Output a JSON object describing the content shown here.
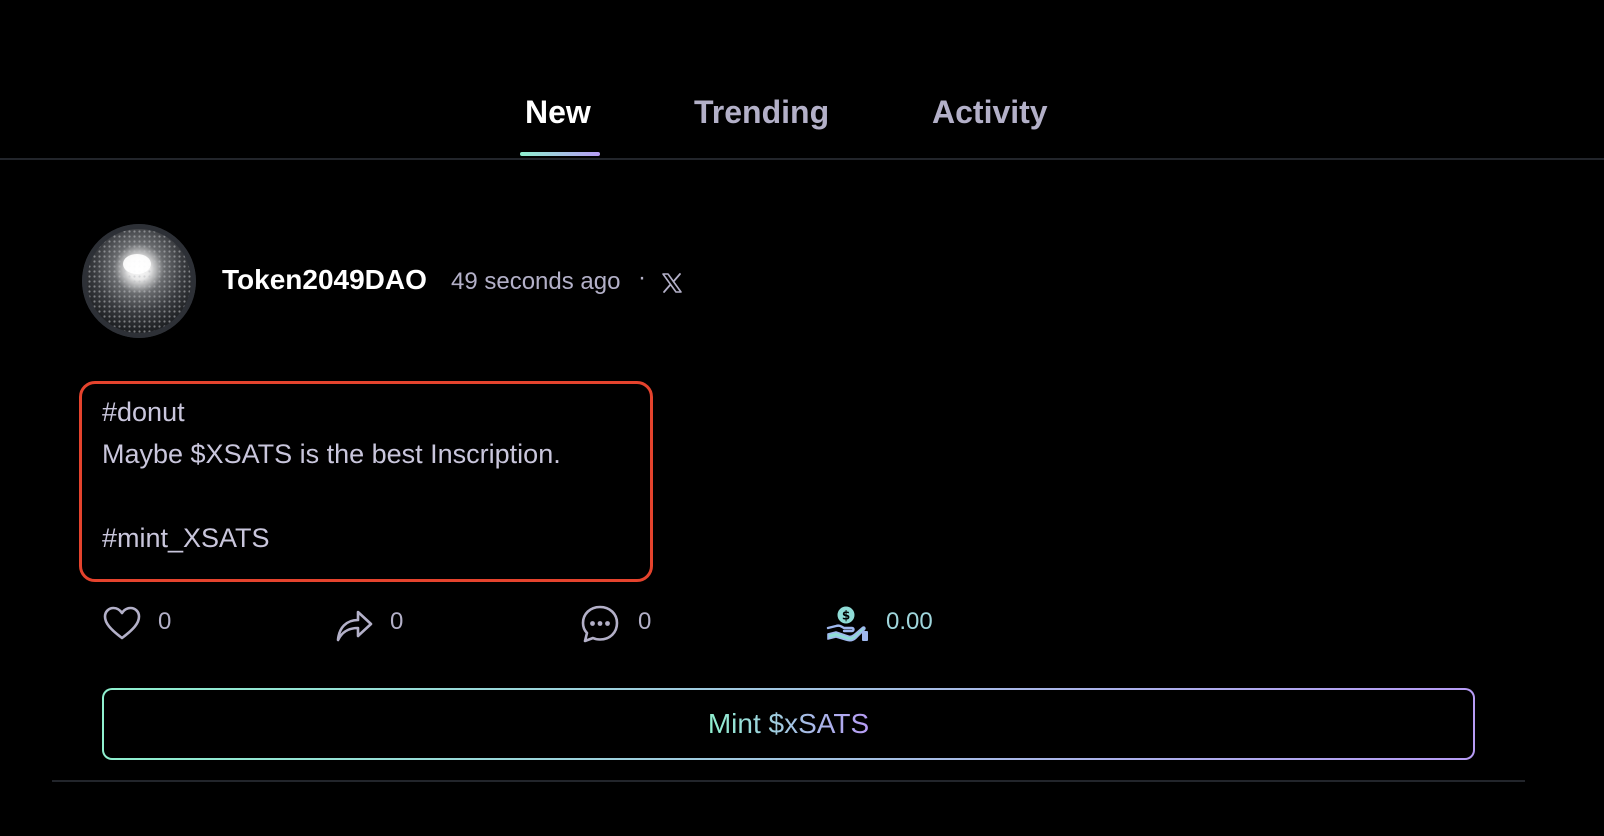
{
  "tabs": [
    {
      "label": "New",
      "active": true
    },
    {
      "label": "Trending",
      "active": false
    },
    {
      "label": "Activity",
      "active": false
    }
  ],
  "post": {
    "author": "Token2049DAO",
    "time": "49 seconds ago",
    "separator": "·",
    "social_icon": "x-logo-icon",
    "body_lines": [
      "#donut",
      "Maybe $XSATS is the best Inscription.",
      "",
      "#mint_XSATS"
    ],
    "actions": {
      "likes": "0",
      "shares": "0",
      "comments": "0",
      "tips": "0.00"
    },
    "mint_label": "Mint $xSATS"
  },
  "colors": {
    "background": "#000000",
    "accent_start": "#8ff0cf",
    "accent_end": "#b79cf5",
    "highlight_border": "#e5432d",
    "muted_text": "#b3b0c8"
  }
}
